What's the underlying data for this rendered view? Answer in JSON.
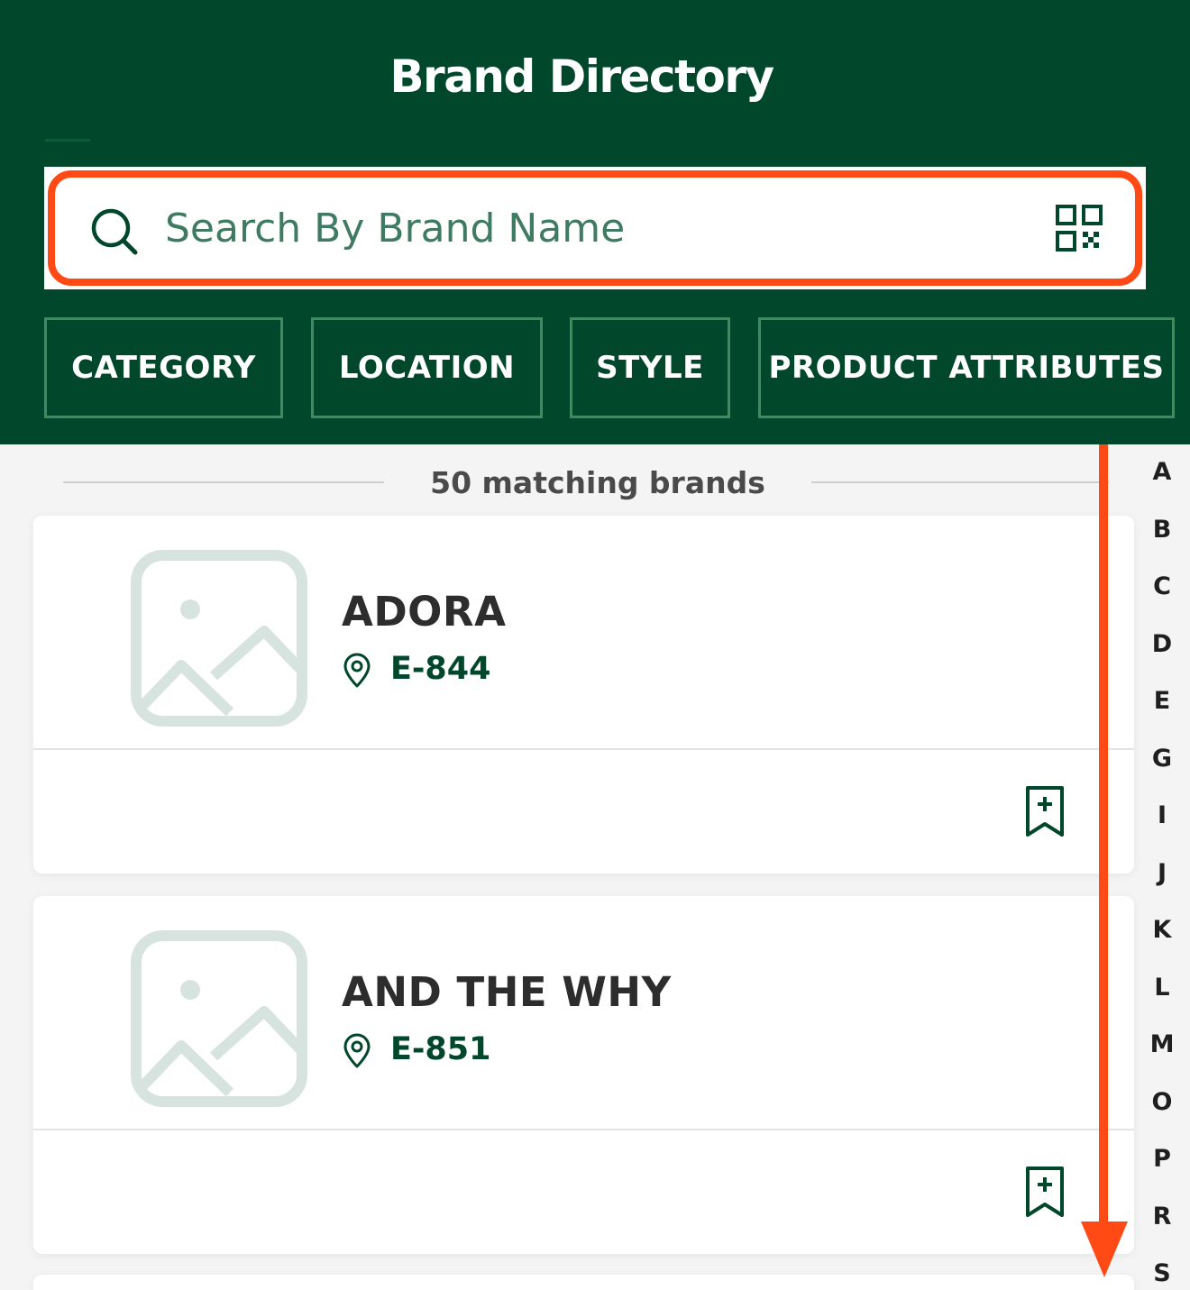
{
  "header": {
    "title": "Brand Directory"
  },
  "search": {
    "placeholder": "Search By Brand Name",
    "value": ""
  },
  "filters": [
    {
      "label": "CATEGORY"
    },
    {
      "label": "LOCATION"
    },
    {
      "label": "STYLE"
    },
    {
      "label": "PRODUCT ATTRIBUTES"
    }
  ],
  "results": {
    "count_text": "50 matching brands"
  },
  "brands": [
    {
      "name": "ADORA",
      "location": "E-844"
    },
    {
      "name": "AND THE WHY",
      "location": "E-851"
    }
  ],
  "alphabet_index": [
    "A",
    "B",
    "C",
    "D",
    "E",
    "G",
    "I",
    "J",
    "K",
    "L",
    "M",
    "O",
    "P",
    "R",
    "S"
  ],
  "colors": {
    "header_bg": "#00472b",
    "accent_annotation": "#ff4a16",
    "location_text": "#00472b"
  },
  "icons": {
    "search": "search-icon",
    "qr": "qr-code-icon",
    "thumbnail": "image-placeholder-icon",
    "location": "map-pin-icon",
    "bookmark": "bookmark-add-icon"
  }
}
